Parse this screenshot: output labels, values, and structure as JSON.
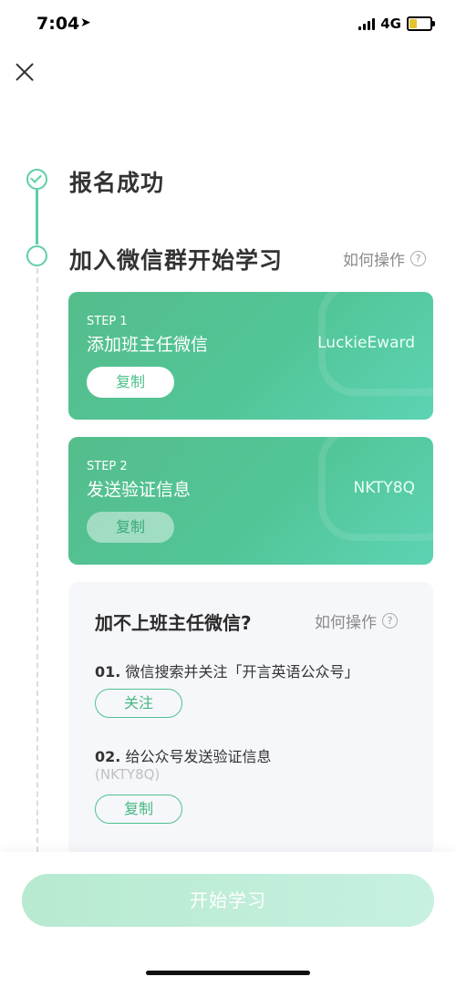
{
  "status": {
    "time": "7:04",
    "network": "4G"
  },
  "timeline": {
    "step1_title": "报名成功",
    "step2_title": "加入微信群开始学习",
    "howto_label": "如何操作"
  },
  "cards": [
    {
      "step_label": "STEP 1",
      "title": "添加班主任微信",
      "value": "LuckieEward",
      "button": "复制"
    },
    {
      "step_label": "STEP 2",
      "title": "发送验证信息",
      "value": "NKTY8Q",
      "button": "复制"
    }
  ],
  "help": {
    "title": "加不上班主任微信?",
    "howto_label": "如何操作",
    "items": [
      {
        "num": "01.",
        "text": "微信搜索并关注「开言英语公众号」",
        "button": "关注"
      },
      {
        "num": "02.",
        "text": "给公众号发送验证信息",
        "sub": "(NKTY8Q)",
        "button": "复制"
      }
    ]
  },
  "bottom": {
    "start_button": "开始学习"
  }
}
